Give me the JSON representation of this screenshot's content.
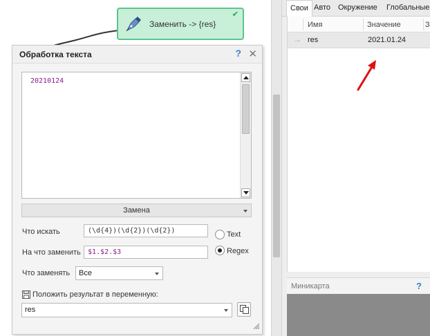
{
  "node": {
    "label": "Заменить -> {res}",
    "icons": {
      "node": "pen-nib-icon",
      "status": "check-icon"
    }
  },
  "dialog": {
    "title": "Обработка текста",
    "help_icon": "?",
    "close_icon": "✕",
    "text_content": "20210124",
    "mode_select": "Замена",
    "find_label": "Что искать",
    "find_value": "(\\d{4})(\\d{2})(\\d{2})",
    "replace_label": "На что заменить",
    "replace_value": "$1.$2.$3",
    "radio_text_label": "Text",
    "radio_regex_label": "Regex",
    "selected_mode": "Regex",
    "what_replace_label": "Что заменять",
    "what_replace_value": "Все",
    "save_var_label": "Положить результат в переменную:",
    "save_var_value": "res",
    "icons": {
      "save": "floppy-disk-icon",
      "copy": "copy-icon",
      "resize": "resize-grip-icon"
    }
  },
  "variables": {
    "tabs": [
      "Свои",
      "Авто",
      "Окружение",
      "Глобальные"
    ],
    "active_tab": "Свои",
    "columns": [
      "Имя",
      "Значение",
      "З"
    ],
    "rows": [
      {
        "name": "res",
        "value": "2021.01.24"
      }
    ]
  },
  "minimap": {
    "title": "Миникарта",
    "help_icon": "?"
  },
  "colors": {
    "node_fill": "#c8f0d8",
    "node_border": "#5cc58c",
    "accent_help": "#2f7fd6",
    "annotation_arrow": "#e01010",
    "highlight_text": "#8b1a8b"
  }
}
